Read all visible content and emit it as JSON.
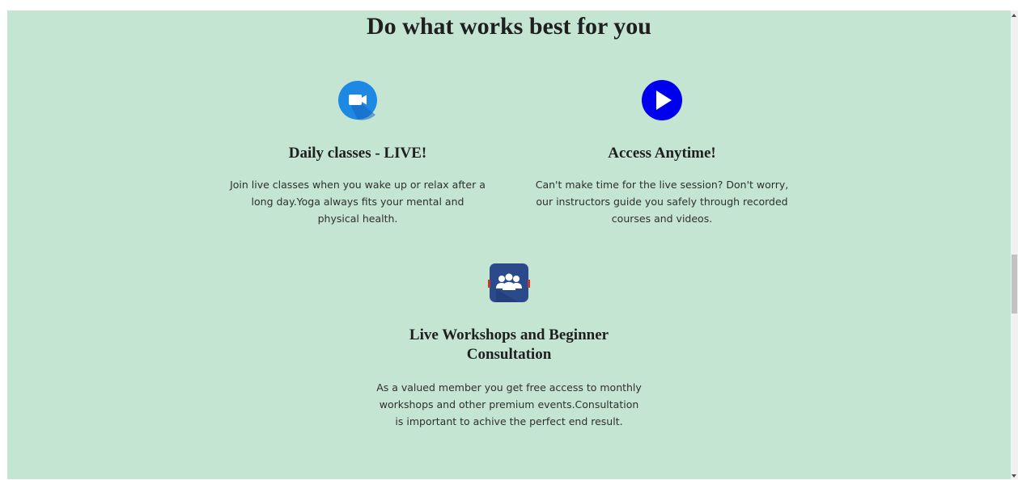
{
  "section": {
    "title": "Do what works best for you"
  },
  "features": [
    {
      "icon": "video-camera-icon",
      "title": "Daily classes - LIVE!",
      "description": "Join live classes when you wake up or relax after a long day.Yoga always fits your mental and physical health."
    },
    {
      "icon": "play-icon",
      "title": "Access Anytime!",
      "description": "Can't make time for the live session? Don't worry, our instructors guide you safely through recorded courses and videos."
    },
    {
      "icon": "group-icon",
      "title": "Live Workshops and Beginner Consultation",
      "description": "As a valued member you get free access to monthly workshops and other premium events.Consultation is important to achive the perfect end result."
    }
  ],
  "colors": {
    "background": "#c3e5d2",
    "video_icon": "#1e88e5",
    "play_icon": "#0000ee",
    "group_icon": "#2b4a8b"
  }
}
